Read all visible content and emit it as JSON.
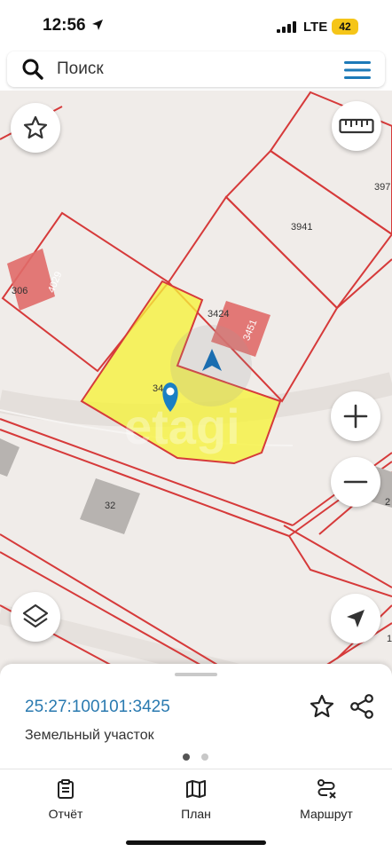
{
  "status_bar": {
    "time": "12:56",
    "network": "LTE",
    "battery": "42"
  },
  "search": {
    "placeholder": "Поиск",
    "icon": "search-icon",
    "menu_icon": "hamburger-menu-icon"
  },
  "map": {
    "labels": {
      "l306": "306",
      "l4029": "4029",
      "l3424": "3424",
      "l3451": "3451",
      "l3941": "3941",
      "l397": "397",
      "l34": "34",
      "l32": "32",
      "l2": "2",
      "l1": "1"
    },
    "watermark": "etagi",
    "colors": {
      "background": "#f0ece9",
      "parcel_border": "#d63a3a",
      "building": "#e0706e",
      "selected_parcel": "#f6f23a",
      "pin": "#1a7fc4"
    },
    "controls": {
      "favorite": "star-icon",
      "ruler": "ruler-icon",
      "zoom_in": "plus-icon",
      "zoom_out": "minus-icon",
      "layers": "layers-icon",
      "locate": "navigation-arrow-icon"
    }
  },
  "sheet": {
    "parcel_id": "25:27:100101:3425",
    "parcel_type": "Земельный участок",
    "page_count": 2,
    "active_page": 1
  },
  "nav": {
    "report": "Отчёт",
    "plan": "План",
    "route": "Маршрут"
  }
}
